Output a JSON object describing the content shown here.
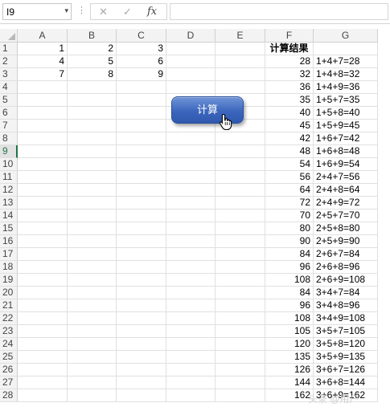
{
  "formula_bar": {
    "name_box": "I9",
    "dots": "⋮",
    "cancel_icon": "✕",
    "enter_icon": "✓",
    "fx_label": "fx",
    "formula": ""
  },
  "columns": [
    "A",
    "B",
    "C",
    "D",
    "E",
    "F",
    "G"
  ],
  "rows": [
    {
      "n": "1",
      "A": "1",
      "B": "2",
      "C": "3",
      "F": "计算结果",
      "G": ""
    },
    {
      "n": "2",
      "A": "4",
      "B": "5",
      "C": "6",
      "F": "28",
      "G": "1+4+7=28"
    },
    {
      "n": "3",
      "A": "7",
      "B": "8",
      "C": "9",
      "F": "32",
      "G": "1+4+8=32"
    },
    {
      "n": "4",
      "F": "36",
      "G": "1+4+9=36"
    },
    {
      "n": "5",
      "F": "35",
      "G": "1+5+7=35"
    },
    {
      "n": "6",
      "F": "40",
      "G": "1+5+8=40"
    },
    {
      "n": "7",
      "F": "45",
      "G": "1+5+9=45"
    },
    {
      "n": "8",
      "F": "42",
      "G": "1+6+7=42"
    },
    {
      "n": "9",
      "F": "48",
      "G": "1+6+8=48"
    },
    {
      "n": "10",
      "F": "54",
      "G": "1+6+9=54"
    },
    {
      "n": "11",
      "F": "56",
      "G": "2+4+7=56"
    },
    {
      "n": "12",
      "F": "64",
      "G": "2+4+8=64"
    },
    {
      "n": "13",
      "F": "72",
      "G": "2+4+9=72"
    },
    {
      "n": "14",
      "F": "70",
      "G": "2+5+7=70"
    },
    {
      "n": "15",
      "F": "80",
      "G": "2+5+8=80"
    },
    {
      "n": "16",
      "F": "90",
      "G": "2+5+9=90"
    },
    {
      "n": "17",
      "F": "84",
      "G": "2+6+7=84"
    },
    {
      "n": "18",
      "F": "96",
      "G": "2+6+8=96"
    },
    {
      "n": "19",
      "F": "108",
      "G": "2+6+9=108"
    },
    {
      "n": "20",
      "F": "84",
      "G": "3+4+7=84"
    },
    {
      "n": "21",
      "F": "96",
      "G": "3+4+8=96"
    },
    {
      "n": "22",
      "F": "108",
      "G": "3+4+9=108"
    },
    {
      "n": "23",
      "F": "105",
      "G": "3+5+7=105"
    },
    {
      "n": "24",
      "F": "120",
      "G": "3+5+8=120"
    },
    {
      "n": "25",
      "F": "135",
      "G": "3+5+9=135"
    },
    {
      "n": "26",
      "F": "126",
      "G": "3+6+7=126"
    },
    {
      "n": "27",
      "F": "144",
      "G": "3+6+8=144"
    },
    {
      "n": "28",
      "F": "162",
      "G": "3+6+9=162"
    }
  ],
  "active_row": "9",
  "button": {
    "label": "计算"
  },
  "watermark": "头条 @用户",
  "colors": {
    "accent": "#217346",
    "button": "#3c66bd"
  }
}
